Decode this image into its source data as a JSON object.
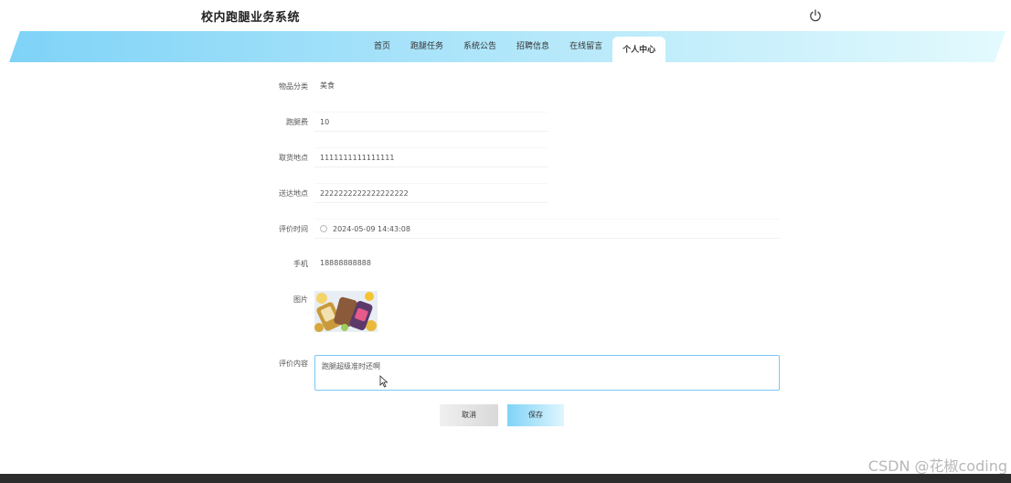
{
  "header": {
    "site_title": "校内跑腿业务系统",
    "power_icon": "power-icon"
  },
  "nav": {
    "items": [
      {
        "label": "首页"
      },
      {
        "label": "跑腿任务"
      },
      {
        "label": "系统公告"
      },
      {
        "label": "招聘信息"
      },
      {
        "label": "在线留言"
      },
      {
        "label": "个人中心"
      }
    ],
    "active": "个人中心",
    "gradient_start": "#7fd3f7",
    "gradient_end": "#e3fafd"
  },
  "form": {
    "category": {
      "label": "物品分类",
      "value": "美食"
    },
    "fee": {
      "label": "跑腿费",
      "value": "10"
    },
    "pickup": {
      "label": "取货地点",
      "value": "1111111111111111"
    },
    "delivery": {
      "label": "送达地点",
      "value": "2222222222222222222"
    },
    "review_time": {
      "label": "评价时间",
      "value": "2024-05-09 14:43:08",
      "icon": "clock-icon"
    },
    "phone": {
      "label": "手机",
      "value": "18888888888"
    },
    "image": {
      "label": "图片"
    },
    "review_content": {
      "label": "评价内容",
      "value": "跑腿超级准时还啊"
    }
  },
  "buttons": {
    "cancel": "取消",
    "save": "保存"
  },
  "watermark": "CSDN @花椒coding"
}
